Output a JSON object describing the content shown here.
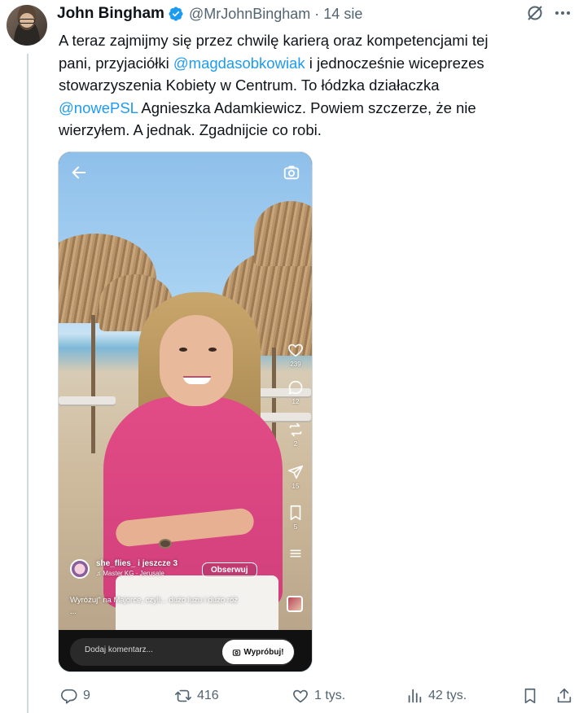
{
  "author": {
    "name": "John Bingham",
    "handle": "@MrJohnBingham",
    "separator": "·",
    "date": "14 sie",
    "verified_color": "#1d9bf0"
  },
  "tweet": {
    "line1": "A teraz zajmijmy się przez chwilę karierą oraz kompetencjami tej",
    "line2_a": "pani, przyjaciółki ",
    "line2_mention": "@magdasobkowiak",
    "line2_b": " i jednocześnie wiceprezes",
    "line3": "stowarzyszenia Kobiety w Centrum. To łódzka działaczka",
    "line4_mention": "@nowePSL",
    "line4_b": " Agnieszka Adamkiewicz. Powiem szczerze, że nie",
    "line5": "wierzyłem. A jednak. Zgadnijcie co robi."
  },
  "media": {
    "side_counts": {
      "likes": "239",
      "comments": "12",
      "reposts": "2",
      "shares": "15",
      "saves": "5"
    },
    "author_line": "she_flies_ i jeszcze 3",
    "music": "Master KG · Jerusale",
    "follow_label": "Obserwuj",
    "caption": "Wyróżuj\" na Majorce, czyli... dużo luzu i dużo róż",
    "caption_more": "...",
    "comment_placeholder": "Dodaj komentarz...",
    "try_label": "Wypróbuj!"
  },
  "stats": {
    "replies": "9",
    "reposts": "416",
    "likes": "1 tys.",
    "views": "42 tys."
  },
  "colors": {
    "accent": "#1d9bf0",
    "muted": "#536471",
    "shirt": "#e24c86"
  }
}
